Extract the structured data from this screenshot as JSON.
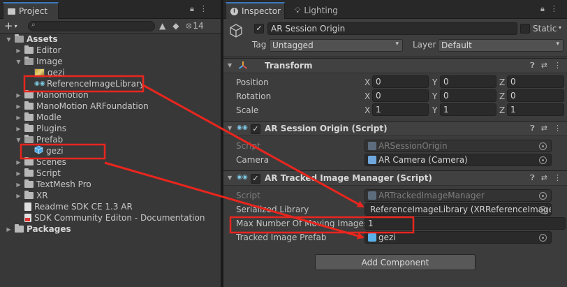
{
  "project": {
    "tab_label": "Project",
    "search_placeholder": "",
    "hidden_count": "14",
    "tree": [
      {
        "label": "Assets",
        "kind": "folder-open",
        "level": 0,
        "expanded": true,
        "bold": true
      },
      {
        "label": "Editor",
        "kind": "folder",
        "level": 1,
        "expanded": false
      },
      {
        "label": "Image",
        "kind": "folder-open",
        "level": 1,
        "expanded": true
      },
      {
        "label": "gezi",
        "kind": "image",
        "level": 2
      },
      {
        "label": "ReferenceImageLibrary",
        "kind": "library",
        "level": 2
      },
      {
        "label": "Manomotion",
        "kind": "folder",
        "level": 1,
        "expanded": false
      },
      {
        "label": "ManoMotion ARFoundation",
        "kind": "folder",
        "level": 1,
        "expanded": false
      },
      {
        "label": "Modle",
        "kind": "folder",
        "level": 1,
        "expanded": false
      },
      {
        "label": "Plugins",
        "kind": "folder",
        "level": 1,
        "expanded": false
      },
      {
        "label": "Prefab",
        "kind": "folder-open",
        "level": 1,
        "expanded": true
      },
      {
        "label": "gezi",
        "kind": "prefab",
        "level": 2
      },
      {
        "label": "Scenes",
        "kind": "folder",
        "level": 1,
        "expanded": false
      },
      {
        "label": "Script",
        "kind": "folder",
        "level": 1,
        "expanded": false
      },
      {
        "label": "TextMesh Pro",
        "kind": "folder",
        "level": 1,
        "expanded": false
      },
      {
        "label": "XR",
        "kind": "folder",
        "level": 1,
        "expanded": false
      },
      {
        "label": "Readme SDK CE 1.3 AR",
        "kind": "doc",
        "level": 1
      },
      {
        "label": "SDK Community Editon - Documentation",
        "kind": "pdf",
        "level": 1
      },
      {
        "label": "Packages",
        "kind": "folder",
        "level": 0,
        "expanded": false,
        "bold": true
      }
    ]
  },
  "inspector": {
    "tabs": [
      {
        "label": "Inspector"
      },
      {
        "label": "Lighting"
      }
    ],
    "object": {
      "name": "AR Session Origin",
      "active": true,
      "static_label": "Static",
      "static": false,
      "tag_label": "Tag",
      "tag_value": "Untagged",
      "layer_label": "Layer",
      "layer_value": "Default"
    },
    "transform": {
      "title": "Transform",
      "position_label": "Position",
      "rotation_label": "Rotation",
      "scale_label": "Scale",
      "axis_x": "X",
      "axis_y": "Y",
      "axis_z": "Z",
      "position": {
        "x": "0",
        "y": "0",
        "z": "0"
      },
      "rotation": {
        "x": "0",
        "y": "0",
        "z": "0"
      },
      "scale": {
        "x": "1",
        "y": "1",
        "z": "1"
      }
    },
    "session_origin": {
      "title": "AR Session Origin (Script)",
      "script_label": "Script",
      "script_value": "ARSessionOrigin",
      "camera_label": "Camera",
      "camera_value": "AR Camera (Camera)"
    },
    "tracked_image_manager": {
      "title": "AR Tracked Image Manager (Script)",
      "script_label": "Script",
      "script_value": "ARTrackedImageManager",
      "library_label": "Serialized Library",
      "library_value": "ReferenceImageLibrary (XRReferenceImageL",
      "max_label": "Max Number Of Moving Images",
      "max_value": "1",
      "prefab_label": "Tracked Image Prefab",
      "prefab_value": "gezi"
    },
    "add_component_label": "Add Component"
  },
  "annotations": {
    "color": "#e8261e"
  }
}
